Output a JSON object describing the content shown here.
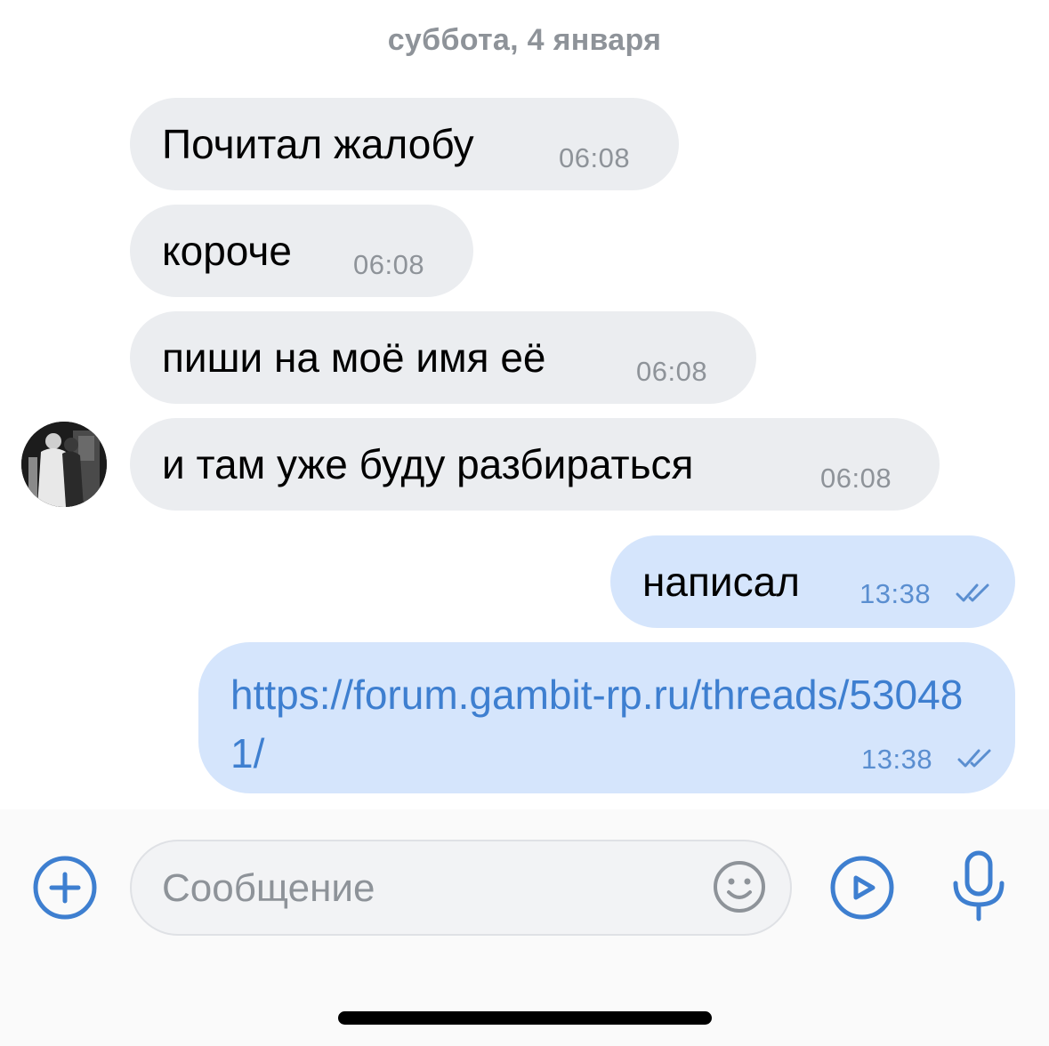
{
  "chat": {
    "date_separator": "суббота, 4 января",
    "messages": [
      {
        "direction": "incoming",
        "text": "Почитал жалобу",
        "time": "06:08"
      },
      {
        "direction": "incoming",
        "text": "короче",
        "time": "06:08"
      },
      {
        "direction": "incoming",
        "text": "пиши на моё имя её",
        "time": "06:08"
      },
      {
        "direction": "incoming",
        "text": "и там уже буду разбираться",
        "time": "06:08"
      },
      {
        "direction": "outgoing",
        "text": "написал",
        "time": "13:38",
        "status": "read"
      },
      {
        "direction": "outgoing",
        "text": "https://forum.gambit-rp.ru/threads/530481/",
        "time": "13:38",
        "status": "read",
        "is_link": true
      }
    ]
  },
  "composer": {
    "placeholder": "Сообщение",
    "attach_icon": "plus-circle-icon",
    "emoji_icon": "smile-icon",
    "video_icon": "play-circle-icon",
    "voice_icon": "microphone-icon"
  },
  "colors": {
    "incoming_bubble": "#ebedf0",
    "outgoing_bubble": "#d5e5fc",
    "accent": "#3e7fd0",
    "secondary_text": "#8e9399"
  }
}
